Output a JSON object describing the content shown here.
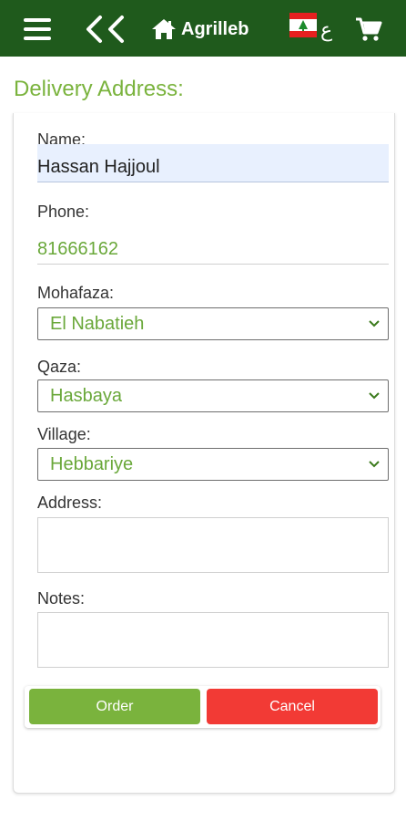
{
  "header": {
    "brand": "Agrilleb",
    "lang_label": "ع"
  },
  "page": {
    "title": "Delivery Address:"
  },
  "form": {
    "name": {
      "label": "Name:",
      "value": "Hassan Hajjoul"
    },
    "phone": {
      "label": "Phone:",
      "value": "81666162"
    },
    "mohafaza": {
      "label": "Mohafaza:",
      "value": "El Nabatieh"
    },
    "qaza": {
      "label": "Qaza:",
      "value": "Hasbaya"
    },
    "village": {
      "label": "Village:",
      "value": "Hebbariye"
    },
    "address": {
      "label": "Address:",
      "value": ""
    },
    "notes": {
      "label": "Notes:",
      "value": ""
    }
  },
  "buttons": {
    "order": "Order",
    "cancel": "Cancel"
  },
  "colors": {
    "header_bg": "#1f5a1c",
    "accent_green": "#7ab33d",
    "cancel_red": "#f23a35"
  }
}
